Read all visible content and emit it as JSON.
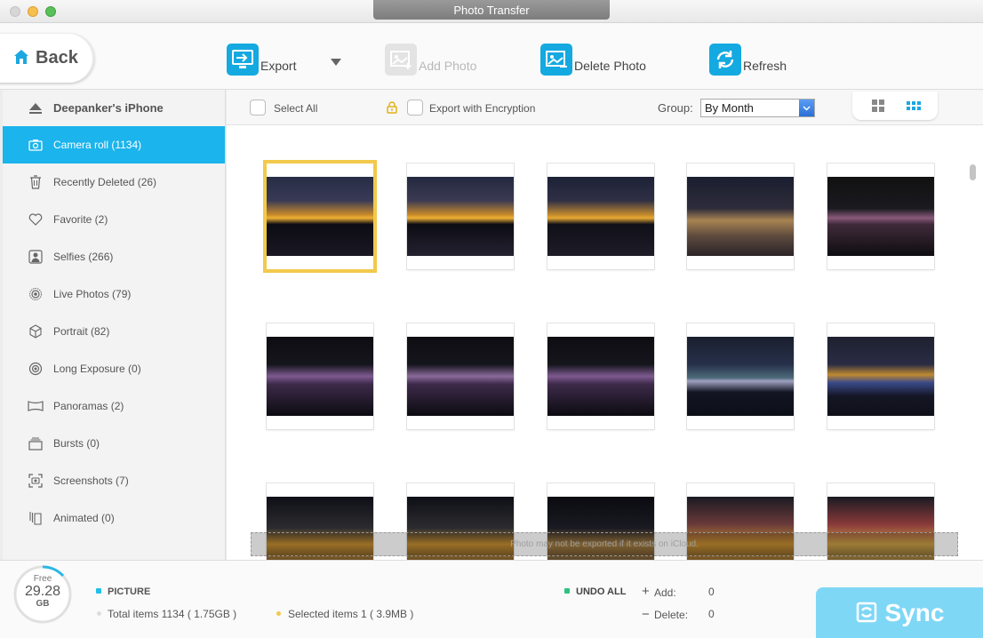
{
  "window": {
    "title": "Photo Transfer"
  },
  "toolbar": {
    "back_label": "Back",
    "export_label": "Export",
    "add_photo_label": "Add Photo",
    "delete_photo_label": "Delete Photo",
    "refresh_label": "Refresh"
  },
  "sidebar": {
    "device_name": "Deepanker's iPhone",
    "items": [
      {
        "label": "Camera roll (1134)",
        "icon": "camera-icon"
      },
      {
        "label": "Recently Deleted (26)",
        "icon": "trash-icon"
      },
      {
        "label": "Favorite (2)",
        "icon": "heart-icon"
      },
      {
        "label": "Selfies (266)",
        "icon": "person-icon"
      },
      {
        "label": "Live Photos (79)",
        "icon": "live-photo-icon"
      },
      {
        "label": "Portrait (82)",
        "icon": "cube-icon"
      },
      {
        "label": "Long Exposure (0)",
        "icon": "long-exposure-icon"
      },
      {
        "label": "Panoramas (2)",
        "icon": "panorama-icon"
      },
      {
        "label": "Bursts (0)",
        "icon": "burst-icon"
      },
      {
        "label": "Screenshots (7)",
        "icon": "screenshot-icon"
      },
      {
        "label": "Animated (0)",
        "icon": "animated-icon"
      }
    ]
  },
  "filter": {
    "select_all_label": "Select All",
    "export_encryption_label": "Export with Encryption",
    "group_label": "Group:",
    "group_value": "By Month"
  },
  "grid": {
    "icloud_note": "Photo may not be exported if it exists on iCloud."
  },
  "footer": {
    "free_label": "Free",
    "free_value": "29.28",
    "free_unit": "GB",
    "picture_label": "PICTURE",
    "total_items": "Total items 1134 ( 1.75GB )",
    "selected_items": "Selected items 1 ( 3.9MB )",
    "undo_all_label": "UNDO ALL",
    "add_label": "Add:",
    "add_value": "0",
    "delete_label": "Delete:",
    "delete_value": "0",
    "sync_label": "Sync"
  },
  "colors": {
    "accent": "#1bb4ec",
    "selected_border": "#f2c94c",
    "picture_dot": "#20c0e8",
    "undo_dot": "#2ec27e",
    "selected_dot": "#f2c94c",
    "sync_button": "#7fd7f6"
  }
}
